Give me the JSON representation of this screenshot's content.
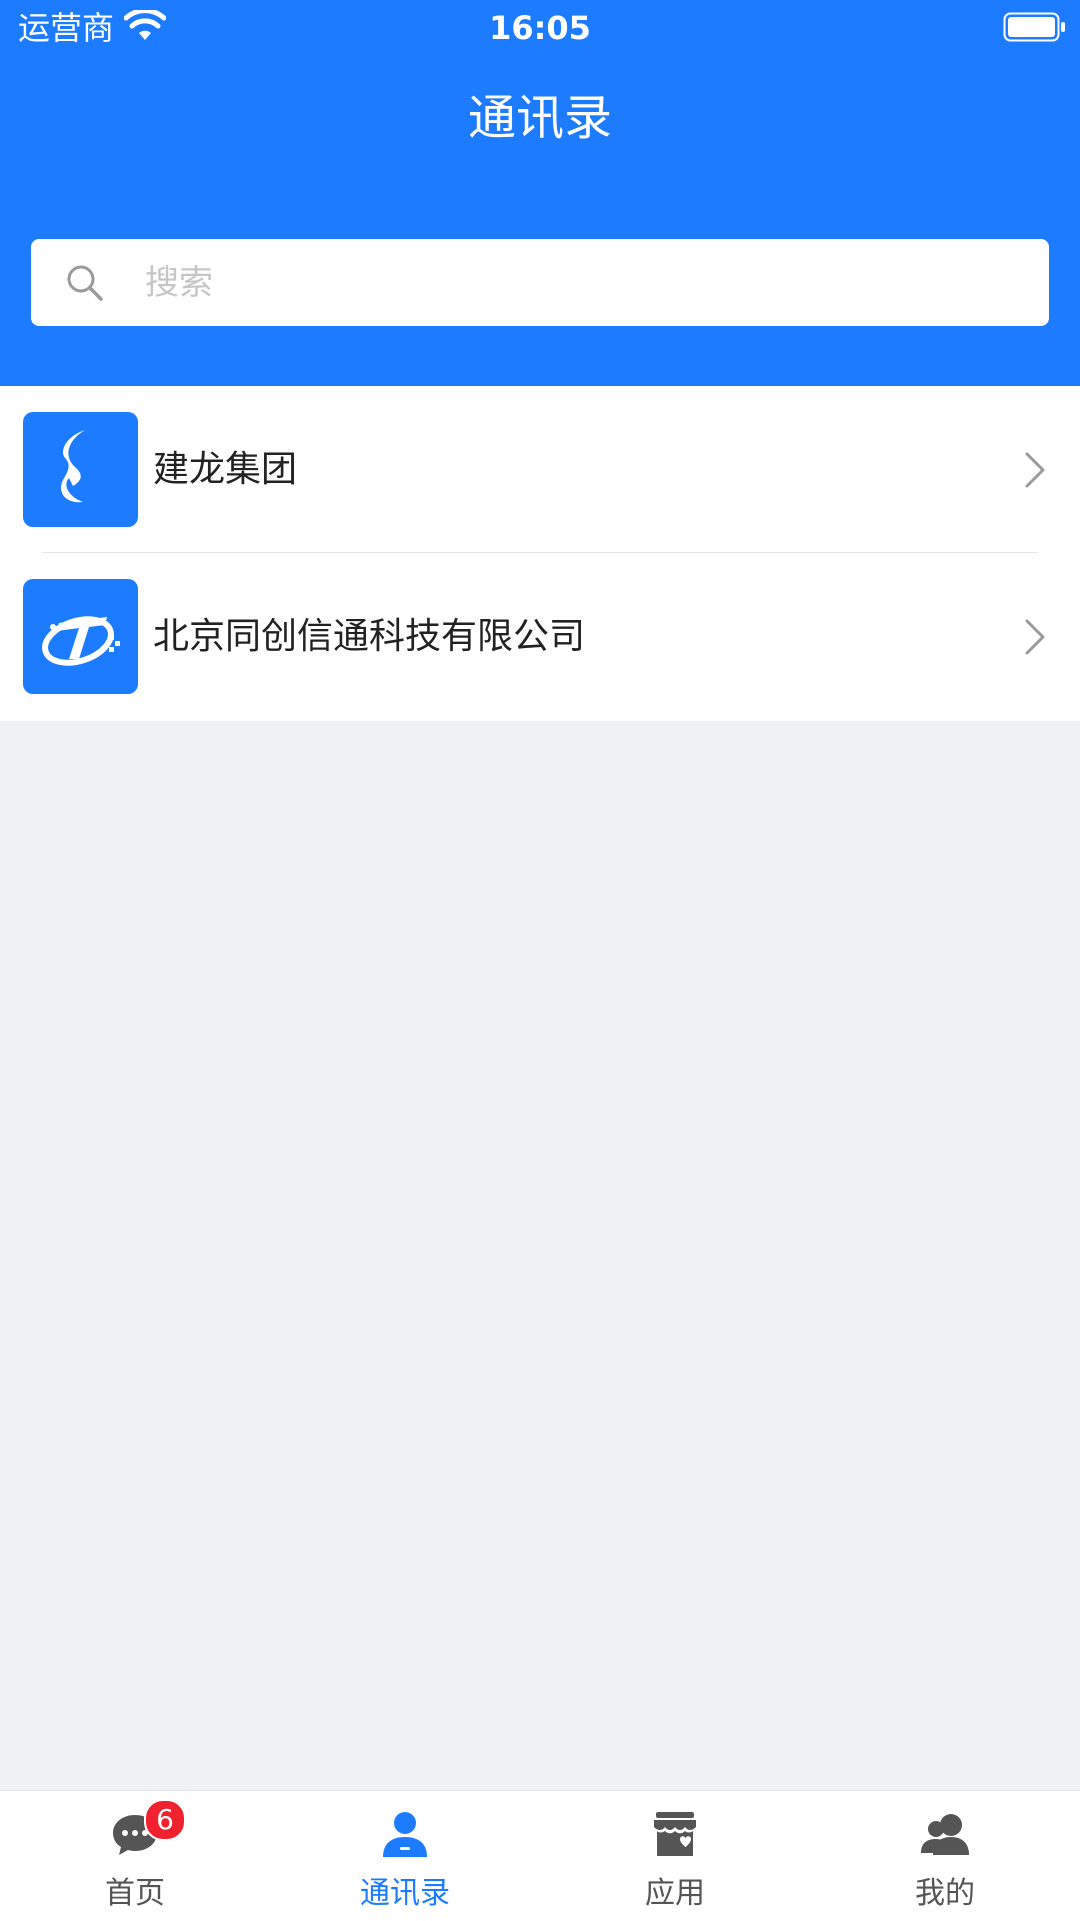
{
  "status_bar": {
    "carrier": "运营商",
    "time": "16:05"
  },
  "header": {
    "title": "通讯录"
  },
  "search": {
    "placeholder": "搜索"
  },
  "organizations": [
    {
      "name": "建龙集团",
      "logo": "jianlong-logo"
    },
    {
      "name": "北京同创信通科技有限公司",
      "logo": "tongchuang-logo"
    }
  ],
  "tabbar": {
    "tabs": [
      {
        "label": "首页",
        "icon": "chat-bubble-icon",
        "badge": "6",
        "active": false
      },
      {
        "label": "通讯录",
        "icon": "person-icon",
        "active": true
      },
      {
        "label": "应用",
        "icon": "store-icon",
        "active": false
      },
      {
        "label": "我的",
        "icon": "users-icon",
        "active": false
      }
    ]
  },
  "colors": {
    "primary": "#1c7bfe",
    "background": "#eff1f5",
    "badge": "#f0222f",
    "inactive": "#555555"
  }
}
